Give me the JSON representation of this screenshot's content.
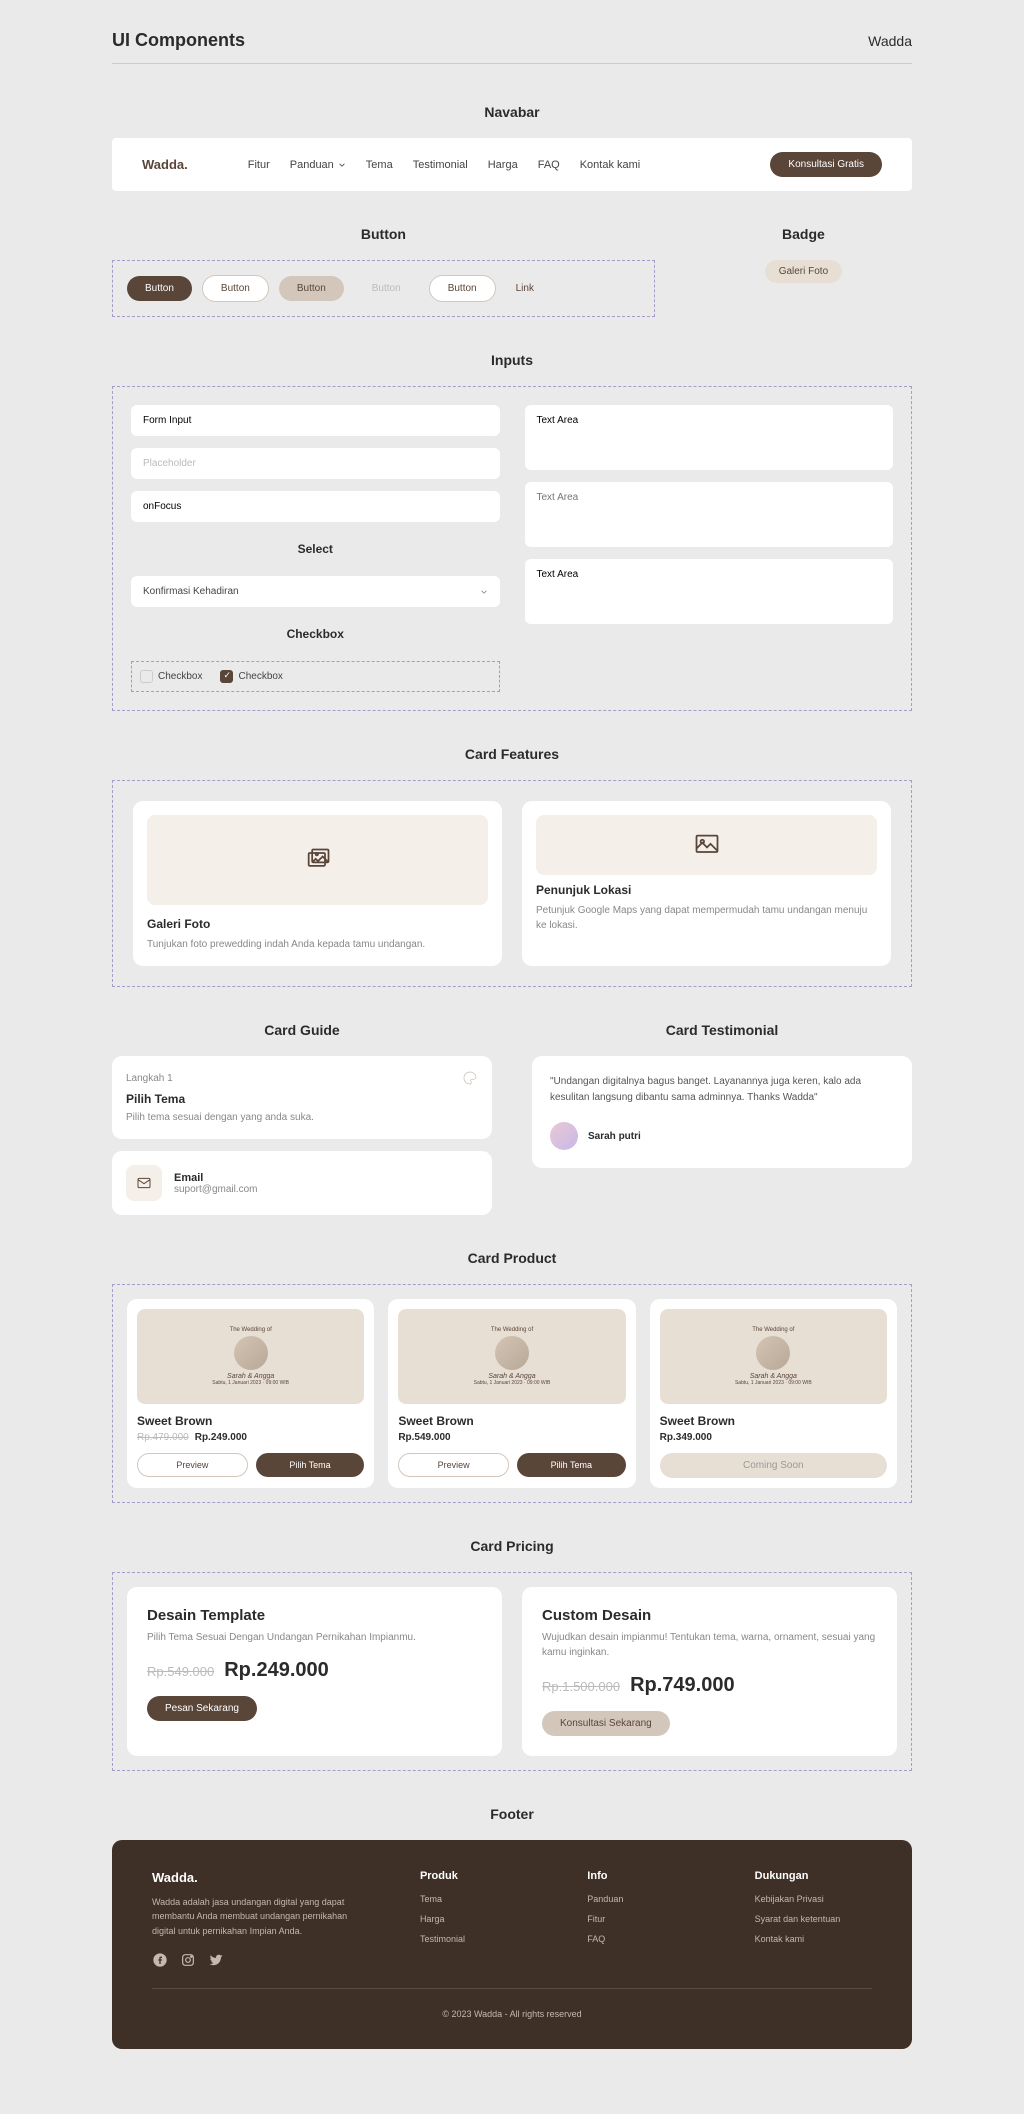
{
  "header": {
    "title": "UI Components",
    "brand": "Wadda"
  },
  "sections": {
    "navbar": "Navabar",
    "button": "Button",
    "badge": "Badge",
    "inputs": "Inputs",
    "select": "Select",
    "checkbox": "Checkbox",
    "features": "Card Features",
    "guide": "Card Guide",
    "testimonial": "Card Testimonial",
    "product": "Card Product",
    "pricing": "Card Pricing",
    "footer": "Footer"
  },
  "navbar": {
    "logo": "Wadda.",
    "links": [
      "Fitur",
      "Panduan",
      "Tema",
      "Testimonial",
      "Harga",
      "FAQ",
      "Kontak kami"
    ],
    "cta": "Konsultasi Gratis"
  },
  "buttons": {
    "primary": "Button",
    "secondary": "Button",
    "tertiary": "Button",
    "ghost": "Button",
    "outline": "Button",
    "link": "Link"
  },
  "badge": {
    "label": "Galeri Foto"
  },
  "inputs": {
    "input1": "Form Input",
    "input2_ph": "Placeholder",
    "input3": "onFocus",
    "select": "Konfirmasi Kehadiran",
    "checkbox1": "Checkbox",
    "checkbox2": "Checkbox",
    "ta1": "Text Area",
    "ta2_ph": "Text Area",
    "ta3": "Text Area"
  },
  "features": [
    {
      "title": "Galeri Foto",
      "desc": "Tunjukan foto prewedding indah Anda kepada tamu undangan."
    },
    {
      "title": "Penunjuk Lokasi",
      "desc": "Petunjuk Google Maps yang dapat mempermudah tamu undangan menuju ke lokasi."
    }
  ],
  "guide": {
    "step": "Langkah 1",
    "title": "Pilih Tema",
    "desc": "Pilih tema sesuai dengan yang anda suka."
  },
  "contact": {
    "label": "Email",
    "value": "suport@gmail.com"
  },
  "testimonial": {
    "text": "\"Undangan digitalnya bagus banget. Layanannya juga keren, kalo ada kesulitan langsung dibantu sama adminnya. Thanks Wadda\"",
    "author": "Sarah putri"
  },
  "products": [
    {
      "title": "Sweet Brown",
      "old": "Rp.479.000",
      "price": "Rp.249.000",
      "preview": "Preview",
      "choose": "Pilih Tema"
    },
    {
      "title": "Sweet Brown",
      "price": "Rp.549.000",
      "preview": "Preview",
      "choose": "Pilih Tema"
    },
    {
      "title": "Sweet Brown",
      "price": "Rp.349.000",
      "coming": "Coming Soon"
    }
  ],
  "product_img": {
    "top": "The Wedding of",
    "names": "Sarah & Angga",
    "date": "Sabtu, 1 Januari 2023 · 09:00 WIB"
  },
  "pricing": [
    {
      "title": "Desain Template",
      "desc": "Pilih Tema Sesuai Dengan Undangan Pernikahan Impianmu.",
      "old": "Rp.549.000",
      "price": "Rp.249.000",
      "btn": "Pesan Sekarang",
      "btn_style": "primary"
    },
    {
      "title": "Custom Desain",
      "desc": "Wujudkan desain impianmu! Tentukan tema, warna, ornament, sesuai yang kamu inginkan.",
      "old": "Rp.1.500.000",
      "price": "Rp.749.000",
      "btn": "Konsultasi Sekarang",
      "btn_style": "tertiary"
    }
  ],
  "footer": {
    "logo": "Wadda.",
    "desc": "Wadda adalah jasa undangan digital yang dapat membantu Anda membuat undangan pernikahan digital untuk pernikahan Impian Anda.",
    "cols": [
      {
        "title": "Produk",
        "links": [
          "Tema",
          "Harga",
          "Testimonial"
        ]
      },
      {
        "title": "Info",
        "links": [
          "Panduan",
          "Fitur",
          "FAQ"
        ]
      },
      {
        "title": "Dukungan",
        "links": [
          "Kebijakan Privasi",
          "Syarat dan ketentuan",
          "Kontak kami"
        ]
      }
    ],
    "copy": "© 2023 Wadda - All rights reserved"
  }
}
